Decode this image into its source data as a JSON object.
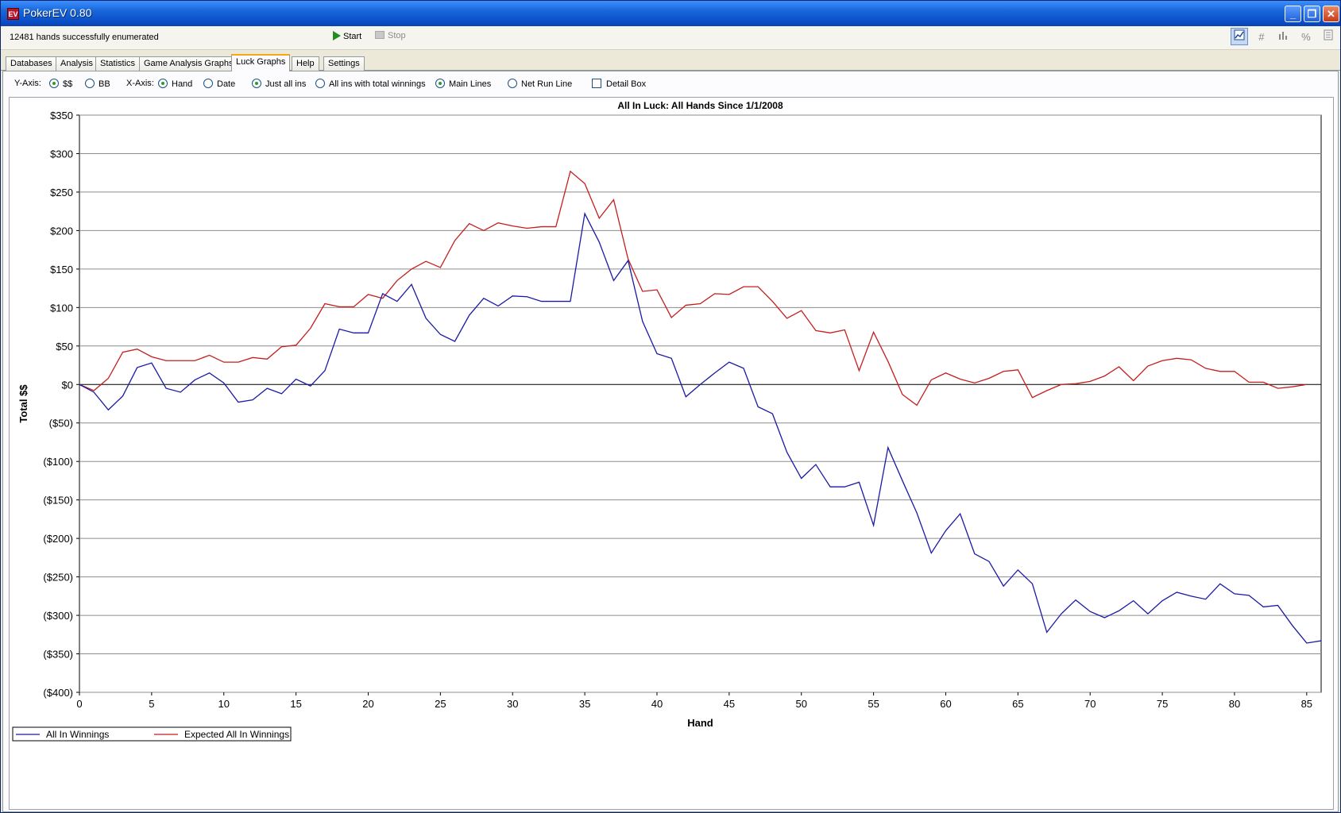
{
  "window": {
    "title": "PokerEV 0.80",
    "icon_label": "EV",
    "buttons": {
      "minimize": "_",
      "restore": "❐",
      "close": "✕"
    }
  },
  "toolbar": {
    "status": "12481 hands successfully enumerated",
    "start_label": "Start",
    "stop_label": "Stop",
    "view_icons": [
      "chart-icon",
      "hash-icon",
      "bars-icon",
      "percent-icon",
      "document-icon"
    ],
    "percent_glyph": "%",
    "hash_glyph": "#"
  },
  "tabs": [
    {
      "label": "Databases",
      "active": false
    },
    {
      "label": "Analysis",
      "active": false
    },
    {
      "label": "Statistics",
      "active": false
    },
    {
      "label": "Game Analysis Graphs",
      "active": false
    },
    {
      "label": "Luck Graphs",
      "active": true
    },
    {
      "label": "Help",
      "active": false
    },
    {
      "label": "Settings",
      "active": false
    }
  ],
  "options": {
    "y_axis_label": "Y-Axis:",
    "y_dollars": {
      "label": "$$",
      "selected": true
    },
    "y_bb": {
      "label": "BB",
      "selected": false
    },
    "x_axis_label": "X-Axis:",
    "x_hand": {
      "label": "Hand",
      "selected": true
    },
    "x_date": {
      "label": "Date",
      "selected": false
    },
    "just_all_ins": {
      "label": "Just all ins",
      "selected": true
    },
    "all_ins_total": {
      "label": "All ins with total winnings",
      "selected": false
    },
    "main_lines": {
      "label": "Main Lines",
      "selected": true
    },
    "net_run_line": {
      "label": "Net Run Line",
      "selected": false
    },
    "detail_box": {
      "label": "Detail Box",
      "checked": false
    }
  },
  "chart_data": {
    "type": "line",
    "title": "All In Luck: All Hands Since 1/1/2008",
    "xlabel": "Hand",
    "ylabel": "Total $$",
    "xlim": [
      0,
      86
    ],
    "ylim": [
      -400,
      350
    ],
    "x_ticks": [
      0,
      5,
      10,
      15,
      20,
      25,
      30,
      35,
      40,
      45,
      50,
      55,
      60,
      65,
      70,
      75,
      80,
      85
    ],
    "y_ticks": [
      350,
      300,
      250,
      200,
      150,
      100,
      50,
      0,
      -50,
      -100,
      -150,
      -200,
      -250,
      -300,
      -350,
      -400
    ],
    "y_tick_labels": [
      "$350",
      "$300",
      "$250",
      "$200",
      "$150",
      "$100",
      "$50",
      "$0",
      "($50)",
      "($100)",
      "($150)",
      "($200)",
      "($250)",
      "($300)",
      "($350)",
      "($400)"
    ],
    "grid": "horizontal",
    "legend_position": "bottom-left",
    "series": [
      {
        "name": "All In Winnings",
        "color": "#1a1aa6",
        "values": [
          0,
          -10,
          -33,
          -15,
          22,
          28,
          -5,
          -10,
          6,
          15,
          2,
          -23,
          -20,
          -5,
          -12,
          7,
          -2,
          18,
          72,
          67,
          67,
          118,
          108,
          130,
          86,
          65,
          56,
          90,
          112,
          102,
          115,
          114,
          108,
          108,
          108,
          222,
          185,
          135,
          161,
          82,
          40,
          34,
          -16,
          0,
          15,
          29,
          21,
          -29,
          -38,
          -88,
          -122,
          -104,
          -133,
          -133,
          -127,
          -183,
          -82,
          -125,
          -167,
          -219,
          -190,
          -168,
          -220,
          -230,
          -262,
          -241,
          -259,
          -322,
          -298,
          -280,
          -295,
          -303,
          -294,
          -281,
          -298,
          -281,
          -270,
          -275,
          -279,
          -259,
          -272,
          -274,
          -289,
          -287,
          -313,
          -336,
          -333
        ]
      },
      {
        "name": "Expected All In Winnings",
        "color": "#c41e1e",
        "values": [
          0,
          -8,
          8,
          42,
          46,
          36,
          31,
          31,
          31,
          38,
          29,
          29,
          35,
          33,
          49,
          51,
          73,
          105,
          101,
          101,
          117,
          112,
          135,
          150,
          160,
          152,
          187,
          209,
          200,
          210,
          206,
          203,
          205,
          205,
          277,
          261,
          216,
          240,
          163,
          121,
          123,
          87,
          103,
          105,
          118,
          117,
          127,
          127,
          108,
          86,
          96,
          70,
          67,
          71,
          18,
          68,
          30,
          -13,
          -27,
          6,
          15,
          7,
          2,
          8,
          17,
          19,
          -17,
          -8,
          0,
          1,
          4,
          11,
          23,
          5,
          24,
          31,
          34,
          32,
          21,
          17,
          17,
          3,
          3,
          -5,
          -3,
          0
        ]
      }
    ]
  }
}
